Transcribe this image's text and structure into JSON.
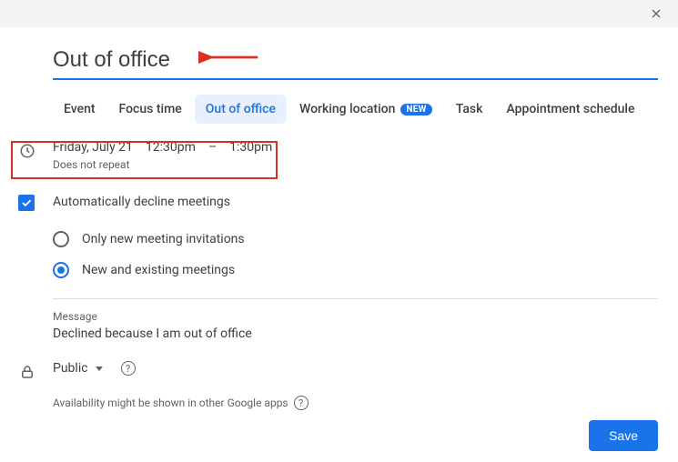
{
  "header": {
    "title": "Out of office"
  },
  "tabs": [
    {
      "label": "Event"
    },
    {
      "label": "Focus time"
    },
    {
      "label": "Out of office"
    },
    {
      "label": "Working location",
      "badge": "NEW"
    },
    {
      "label": "Task"
    },
    {
      "label": "Appointment schedule"
    }
  ],
  "active_tab_index": 2,
  "datetime": {
    "date": "Friday, July 21",
    "start": "12:30pm",
    "sep": "–",
    "end": "1:30pm",
    "repeat": "Does not repeat"
  },
  "auto_decline": {
    "label": "Automatically decline meetings",
    "checked": true,
    "options": [
      {
        "label": "Only new meeting invitations"
      },
      {
        "label": "New and existing meetings"
      }
    ],
    "selected_option_index": 1
  },
  "message": {
    "label": "Message",
    "text": "Declined because I am out of office"
  },
  "visibility": {
    "value": "Public"
  },
  "availability_note": "Availability might be shown in other Google apps",
  "buttons": {
    "save": "Save"
  },
  "colors": {
    "primary": "#1a73e8",
    "annotation": "#d93025"
  }
}
